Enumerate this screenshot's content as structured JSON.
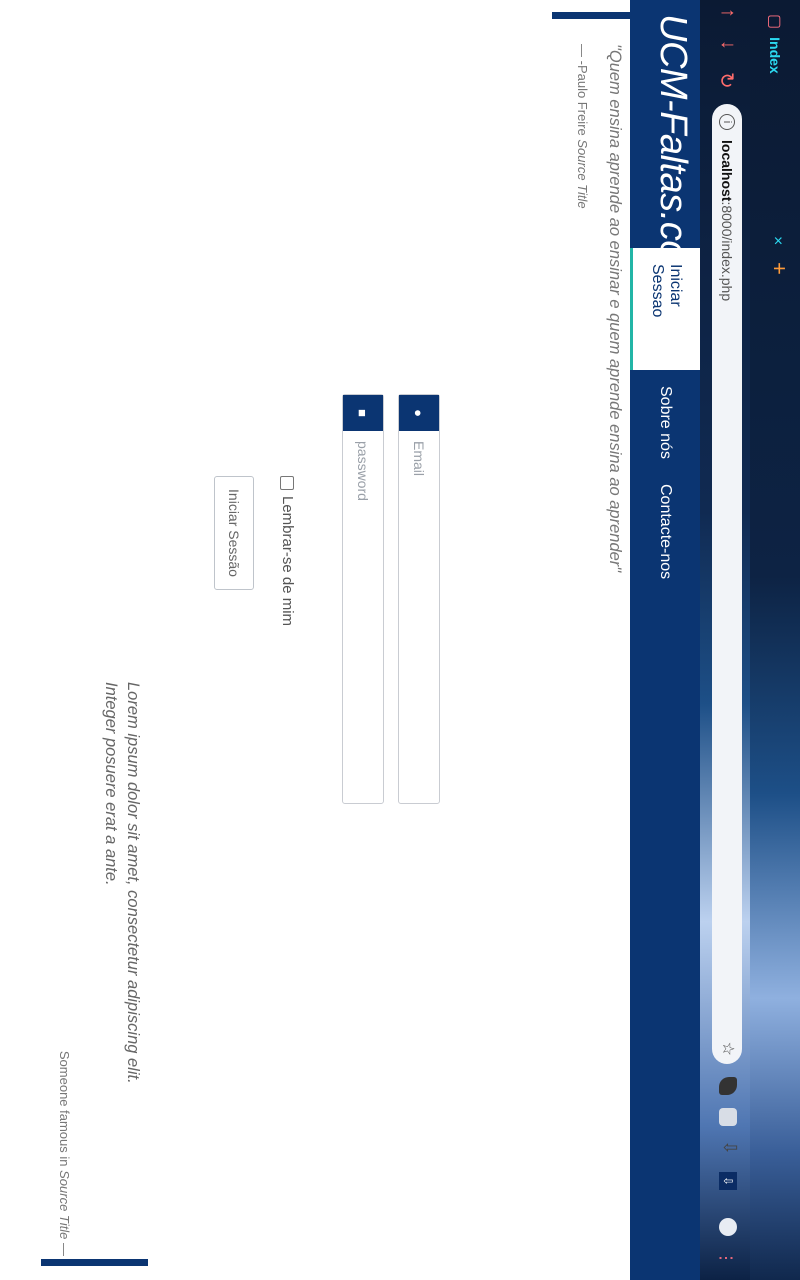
{
  "browser": {
    "tab_title": "Index",
    "tab_close": "×",
    "new_tab": "+",
    "back": "↑",
    "forward": "↓",
    "reload": "↻",
    "info": "i",
    "url_host": "localhost",
    "url_rest": ":8000/index.php",
    "star": "☆",
    "menu": "⋮"
  },
  "site": {
    "brand": "UCM-Faltas.com",
    "nav": {
      "login": "Iniciar Sessao",
      "about": "Sobre nós",
      "contact": "Contacte-nos"
    }
  },
  "quote1": {
    "text": "\"Quem ensina aprende ao ensinar e quem aprende ensina ao aprender\"",
    "source_prefix": "— -Paulo Freire",
    "source_title": "Source Title"
  },
  "form": {
    "email_placeholder": "Email",
    "password_placeholder": "password",
    "remember_label": "Lembrar-se de mim",
    "submit_label": "Iniciar Sessão"
  },
  "quote2": {
    "text": "Lorem ipsum dolor sit amet, consectetur adipiscing elit. Integer posuere erat a ante.",
    "source_prefix": "Someone famous in",
    "source_title": "Source Title",
    "source_suffix": " —"
  },
  "colors": {
    "brand_navy": "#0b3572",
    "active_underline": "#22b5a6",
    "tab_title": "#2bd9f0"
  }
}
